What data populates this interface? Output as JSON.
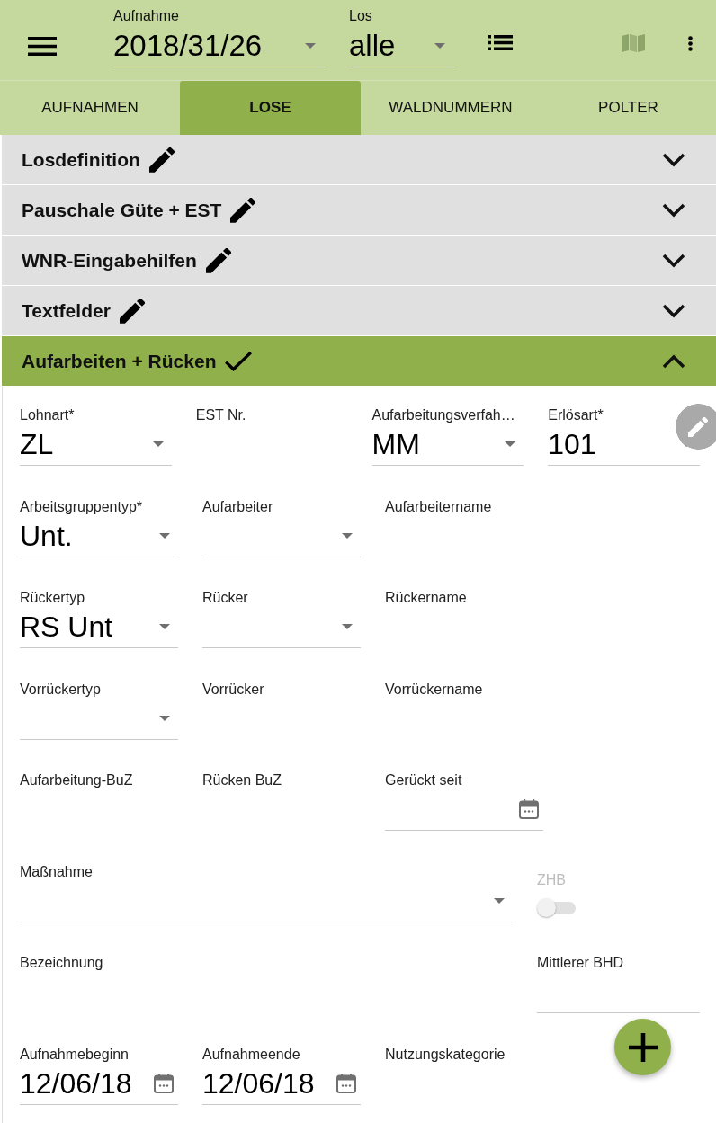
{
  "app_bar": {
    "fields": [
      {
        "label": "Aufnahme",
        "value": "2018/31/26"
      },
      {
        "label": "Los",
        "value": "alle"
      }
    ],
    "actions": [
      {
        "kind": "list",
        "disabled": false
      },
      {
        "kind": "map",
        "disabled": true
      }
    ]
  },
  "tabs": [
    {
      "label": "AUFNAHMEN",
      "selected": false
    },
    {
      "label": "LOSE",
      "selected": true
    },
    {
      "label": "WALDNUMMERN",
      "selected": false
    },
    {
      "label": "POLTER",
      "selected": false
    }
  ],
  "sections": [
    {
      "title": "Losdefinition",
      "complete": false,
      "expanded": false
    },
    {
      "title": "Pauschale Güte + EST",
      "complete": false,
      "expanded": false
    },
    {
      "title": "WNR-Eingabehilfen",
      "complete": false,
      "expanded": false
    },
    {
      "title": "Textfelder",
      "complete": false,
      "expanded": false
    },
    {
      "title": "Aufarbeiten + Rücken",
      "complete": true,
      "expanded": true,
      "rows": [
        {
          "fields": [
            {
              "kind": "select",
              "label": "Lohnart*",
              "value": "ZL"
            },
            {
              "kind": "readonly",
              "label": "EST Nr."
            },
            {
              "kind": "select",
              "label": "Aufarbeitungsverfah…",
              "value": "MM"
            },
            {
              "kind": "select",
              "label": "Erlösart*",
              "value": "101"
            }
          ]
        },
        {
          "fields": [
            {
              "kind": "select",
              "label": "Arbeitsgruppentyp*",
              "value": "Unt."
            },
            {
              "kind": "select",
              "label": "Aufarbeiter"
            },
            {
              "kind": "readonly",
              "label": "Aufarbeitername"
            }
          ]
        },
        {
          "fields": [
            {
              "kind": "select",
              "label": "Rückertyp",
              "value": "RS Unt"
            },
            {
              "kind": "select",
              "label": "Rücker"
            },
            {
              "kind": "readonly",
              "label": "Rückername"
            }
          ]
        },
        {
          "fields": [
            {
              "kind": "select",
              "label": "Vorrückertyp"
            },
            {
              "kind": "readonly",
              "label": "Vorrücker"
            },
            {
              "kind": "readonly",
              "label": "Vorrückername"
            }
          ]
        },
        {
          "fields": [
            {
              "kind": "readonly",
              "label": "Aufarbeitung-BuZ"
            },
            {
              "kind": "readonly",
              "label": "Rücken BuZ"
            },
            {
              "kind": "date",
              "label": "Gerückt seit"
            }
          ]
        },
        {
          "fields": [
            {
              "kind": "select",
              "label": "Maßnahme"
            },
            {
              "kind": "switch",
              "label": "ZHB",
              "on": false,
              "disabled": true
            }
          ]
        },
        {
          "fields": [
            {
              "kind": "readonly",
              "label": "Bezeichnung"
            },
            {
              "kind": "text",
              "label": "Mittlerer BHD"
            }
          ]
        },
        {
          "fields": [
            {
              "kind": "date",
              "label": "Aufnahmebeginn",
              "value": "12/06/18"
            },
            {
              "kind": "date",
              "label": "Aufnahmeende",
              "value": "12/06/18"
            },
            {
              "kind": "readonly",
              "label": "Nutzungskategorie"
            }
          ]
        }
      ]
    }
  ]
}
